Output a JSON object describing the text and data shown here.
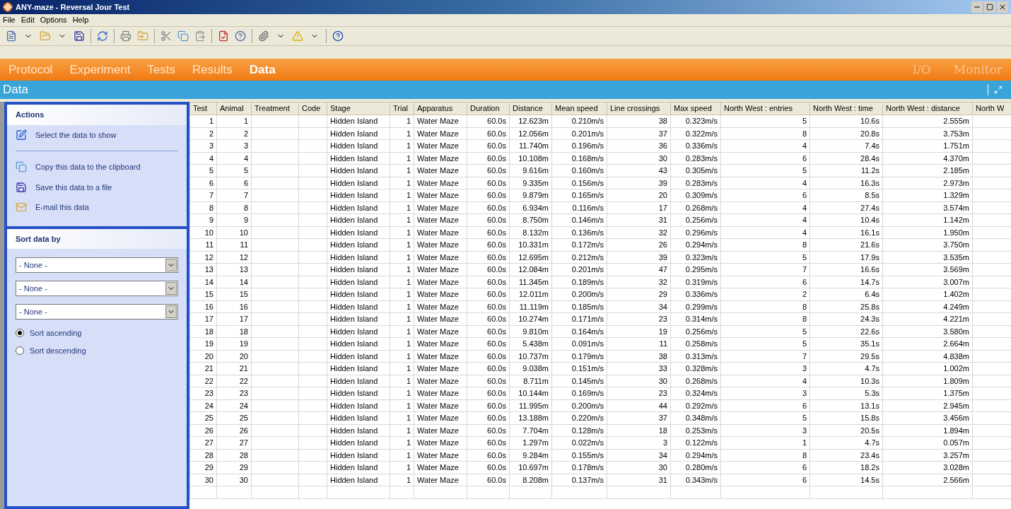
{
  "window": {
    "title": "ANY-maze - Reversal Jour Test"
  },
  "menu": [
    "File",
    "Edit",
    "Options",
    "Help"
  ],
  "nav": {
    "tabs": [
      {
        "label": "Protocol",
        "selected": false
      },
      {
        "label": "Experiment",
        "selected": false
      },
      {
        "label": "Tests",
        "selected": false
      },
      {
        "label": "Results",
        "selected": false
      },
      {
        "label": "Data",
        "selected": true
      }
    ],
    "right_tabs": [
      {
        "label": "I/O",
        "disabled": true
      },
      {
        "label": "Monitor",
        "disabled": true
      }
    ]
  },
  "section_title": "Data",
  "sidebar": {
    "actions": {
      "title": "Actions",
      "items": [
        "Select the data to show",
        "Copy this data to the clipboard",
        "Save this data to a file",
        "E-mail this data"
      ]
    },
    "sort": {
      "title": "Sort data by",
      "selects": [
        "- None -",
        "- None -",
        "- None -"
      ],
      "options": [
        {
          "label": "Sort ascending",
          "selected": true
        },
        {
          "label": "Sort descending",
          "selected": false
        }
      ]
    }
  },
  "table": {
    "columns": [
      {
        "label": "Test",
        "kind": "number"
      },
      {
        "label": "Animal",
        "kind": "number"
      },
      {
        "label": "Treatment"
      },
      {
        "label": "Code"
      },
      {
        "label": "Stage",
        "kind": "text"
      },
      {
        "label": "Trial",
        "kind": "number"
      },
      {
        "label": "Apparatus",
        "kind": "text"
      },
      {
        "label": "Duration",
        "kind": "number"
      },
      {
        "label": "Distance",
        "kind": "number"
      },
      {
        "label": "Mean speed",
        "kind": "number"
      },
      {
        "label": "Line crossings",
        "kind": "number"
      },
      {
        "label": "Max speed",
        "kind": "number"
      },
      {
        "label": "North West : entries",
        "kind": "number"
      },
      {
        "label": "North West : time",
        "kind": "number"
      },
      {
        "label": "North West : distance",
        "kind": "number"
      },
      {
        "label": "North W"
      }
    ],
    "rows": [
      [
        "1",
        "1",
        "",
        "",
        "Hidden Island",
        "1",
        "Water Maze",
        "60.0s",
        "12.623m",
        "0.210m/s",
        "38",
        "0.323m/s",
        "5",
        "10.6s",
        "2.555m"
      ],
      [
        "2",
        "2",
        "",
        "",
        "Hidden Island",
        "1",
        "Water Maze",
        "60.0s",
        "12.056m",
        "0.201m/s",
        "37",
        "0.322m/s",
        "8",
        "20.8s",
        "3.753m"
      ],
      [
        "3",
        "3",
        "",
        "",
        "Hidden Island",
        "1",
        "Water Maze",
        "60.0s",
        "11.740m",
        "0.196m/s",
        "36",
        "0.336m/s",
        "4",
        "7.4s",
        "1.751m"
      ],
      [
        "4",
        "4",
        "",
        "",
        "Hidden Island",
        "1",
        "Water Maze",
        "60.0s",
        "10.108m",
        "0.168m/s",
        "30",
        "0.283m/s",
        "6",
        "28.4s",
        "4.370m"
      ],
      [
        "5",
        "5",
        "",
        "",
        "Hidden Island",
        "1",
        "Water Maze",
        "60.0s",
        "9.616m",
        "0.160m/s",
        "43",
        "0.305m/s",
        "5",
        "11.2s",
        "2.185m"
      ],
      [
        "6",
        "6",
        "",
        "",
        "Hidden Island",
        "1",
        "Water Maze",
        "60.0s",
        "9.335m",
        "0.156m/s",
        "39",
        "0.283m/s",
        "4",
        "16.3s",
        "2.973m"
      ],
      [
        "7",
        "7",
        "",
        "",
        "Hidden Island",
        "1",
        "Water Maze",
        "60.0s",
        "9.879m",
        "0.165m/s",
        "20",
        "0.309m/s",
        "6",
        "8.5s",
        "1.329m"
      ],
      [
        "8",
        "8",
        "",
        "",
        "Hidden Island",
        "1",
        "Water Maze",
        "60.0s",
        "6.934m",
        "0.116m/s",
        "17",
        "0.268m/s",
        "4",
        "27.4s",
        "3.574m"
      ],
      [
        "9",
        "9",
        "",
        "",
        "Hidden Island",
        "1",
        "Water Maze",
        "60.0s",
        "8.750m",
        "0.146m/s",
        "31",
        "0.256m/s",
        "4",
        "10.4s",
        "1.142m"
      ],
      [
        "10",
        "10",
        "",
        "",
        "Hidden Island",
        "1",
        "Water Maze",
        "60.0s",
        "8.132m",
        "0.136m/s",
        "32",
        "0.296m/s",
        "4",
        "16.1s",
        "1.950m"
      ],
      [
        "11",
        "11",
        "",
        "",
        "Hidden Island",
        "1",
        "Water Maze",
        "60.0s",
        "10.331m",
        "0.172m/s",
        "26",
        "0.294m/s",
        "8",
        "21.6s",
        "3.750m"
      ],
      [
        "12",
        "12",
        "",
        "",
        "Hidden Island",
        "1",
        "Water Maze",
        "60.0s",
        "12.695m",
        "0.212m/s",
        "39",
        "0.323m/s",
        "5",
        "17.9s",
        "3.535m"
      ],
      [
        "13",
        "13",
        "",
        "",
        "Hidden Island",
        "1",
        "Water Maze",
        "60.0s",
        "12.084m",
        "0.201m/s",
        "47",
        "0.295m/s",
        "7",
        "16.6s",
        "3.569m"
      ],
      [
        "14",
        "14",
        "",
        "",
        "Hidden Island",
        "1",
        "Water Maze",
        "60.0s",
        "11.345m",
        "0.189m/s",
        "32",
        "0.319m/s",
        "6",
        "14.7s",
        "3.007m"
      ],
      [
        "15",
        "15",
        "",
        "",
        "Hidden Island",
        "1",
        "Water Maze",
        "60.0s",
        "12.011m",
        "0.200m/s",
        "29",
        "0.336m/s",
        "2",
        "6.4s",
        "1.402m"
      ],
      [
        "16",
        "16",
        "",
        "",
        "Hidden Island",
        "1",
        "Water Maze",
        "60.0s",
        "11.119m",
        "0.185m/s",
        "34",
        "0.299m/s",
        "8",
        "25.8s",
        "4.249m"
      ],
      [
        "17",
        "17",
        "",
        "",
        "Hidden Island",
        "1",
        "Water Maze",
        "60.0s",
        "10.274m",
        "0.171m/s",
        "23",
        "0.314m/s",
        "8",
        "24.3s",
        "4.221m"
      ],
      [
        "18",
        "18",
        "",
        "",
        "Hidden Island",
        "1",
        "Water Maze",
        "60.0s",
        "9.810m",
        "0.164m/s",
        "19",
        "0.256m/s",
        "5",
        "22.6s",
        "3.580m"
      ],
      [
        "19",
        "19",
        "",
        "",
        "Hidden Island",
        "1",
        "Water Maze",
        "60.0s",
        "5.438m",
        "0.091m/s",
        "11",
        "0.258m/s",
        "5",
        "35.1s",
        "2.664m"
      ],
      [
        "20",
        "20",
        "",
        "",
        "Hidden Island",
        "1",
        "Water Maze",
        "60.0s",
        "10.737m",
        "0.179m/s",
        "38",
        "0.313m/s",
        "7",
        "29.5s",
        "4.838m"
      ],
      [
        "21",
        "21",
        "",
        "",
        "Hidden Island",
        "1",
        "Water Maze",
        "60.0s",
        "9.038m",
        "0.151m/s",
        "33",
        "0.328m/s",
        "3",
        "4.7s",
        "1.002m"
      ],
      [
        "22",
        "22",
        "",
        "",
        "Hidden Island",
        "1",
        "Water Maze",
        "60.0s",
        "8.711m",
        "0.145m/s",
        "30",
        "0.268m/s",
        "4",
        "10.3s",
        "1.809m"
      ],
      [
        "23",
        "23",
        "",
        "",
        "Hidden Island",
        "1",
        "Water Maze",
        "60.0s",
        "10.144m",
        "0.169m/s",
        "23",
        "0.324m/s",
        "3",
        "5.3s",
        "1.375m"
      ],
      [
        "24",
        "24",
        "",
        "",
        "Hidden Island",
        "1",
        "Water Maze",
        "60.0s",
        "11.995m",
        "0.200m/s",
        "44",
        "0.292m/s",
        "6",
        "13.1s",
        "2.945m"
      ],
      [
        "25",
        "25",
        "",
        "",
        "Hidden Island",
        "1",
        "Water Maze",
        "60.0s",
        "13.188m",
        "0.220m/s",
        "37",
        "0.348m/s",
        "5",
        "15.8s",
        "3.456m"
      ],
      [
        "26",
        "26",
        "",
        "",
        "Hidden Island",
        "1",
        "Water Maze",
        "60.0s",
        "7.704m",
        "0.128m/s",
        "18",
        "0.253m/s",
        "3",
        "20.5s",
        "1.894m"
      ],
      [
        "27",
        "27",
        "",
        "",
        "Hidden Island",
        "1",
        "Water Maze",
        "60.0s",
        "1.297m",
        "0.022m/s",
        "3",
        "0.122m/s",
        "1",
        "4.7s",
        "0.057m"
      ],
      [
        "28",
        "28",
        "",
        "",
        "Hidden Island",
        "1",
        "Water Maze",
        "60.0s",
        "9.284m",
        "0.155m/s",
        "34",
        "0.294m/s",
        "8",
        "23.4s",
        "3.257m"
      ],
      [
        "29",
        "29",
        "",
        "",
        "Hidden Island",
        "1",
        "Water Maze",
        "60.0s",
        "10.697m",
        "0.178m/s",
        "30",
        "0.280m/s",
        "6",
        "18.2s",
        "3.028m"
      ],
      [
        "30",
        "30",
        "",
        "",
        "Hidden Island",
        "1",
        "Water Maze",
        "60.0s",
        "8.208m",
        "0.137m/s",
        "31",
        "0.343m/s",
        "6",
        "14.5s",
        "2.566m"
      ]
    ]
  }
}
